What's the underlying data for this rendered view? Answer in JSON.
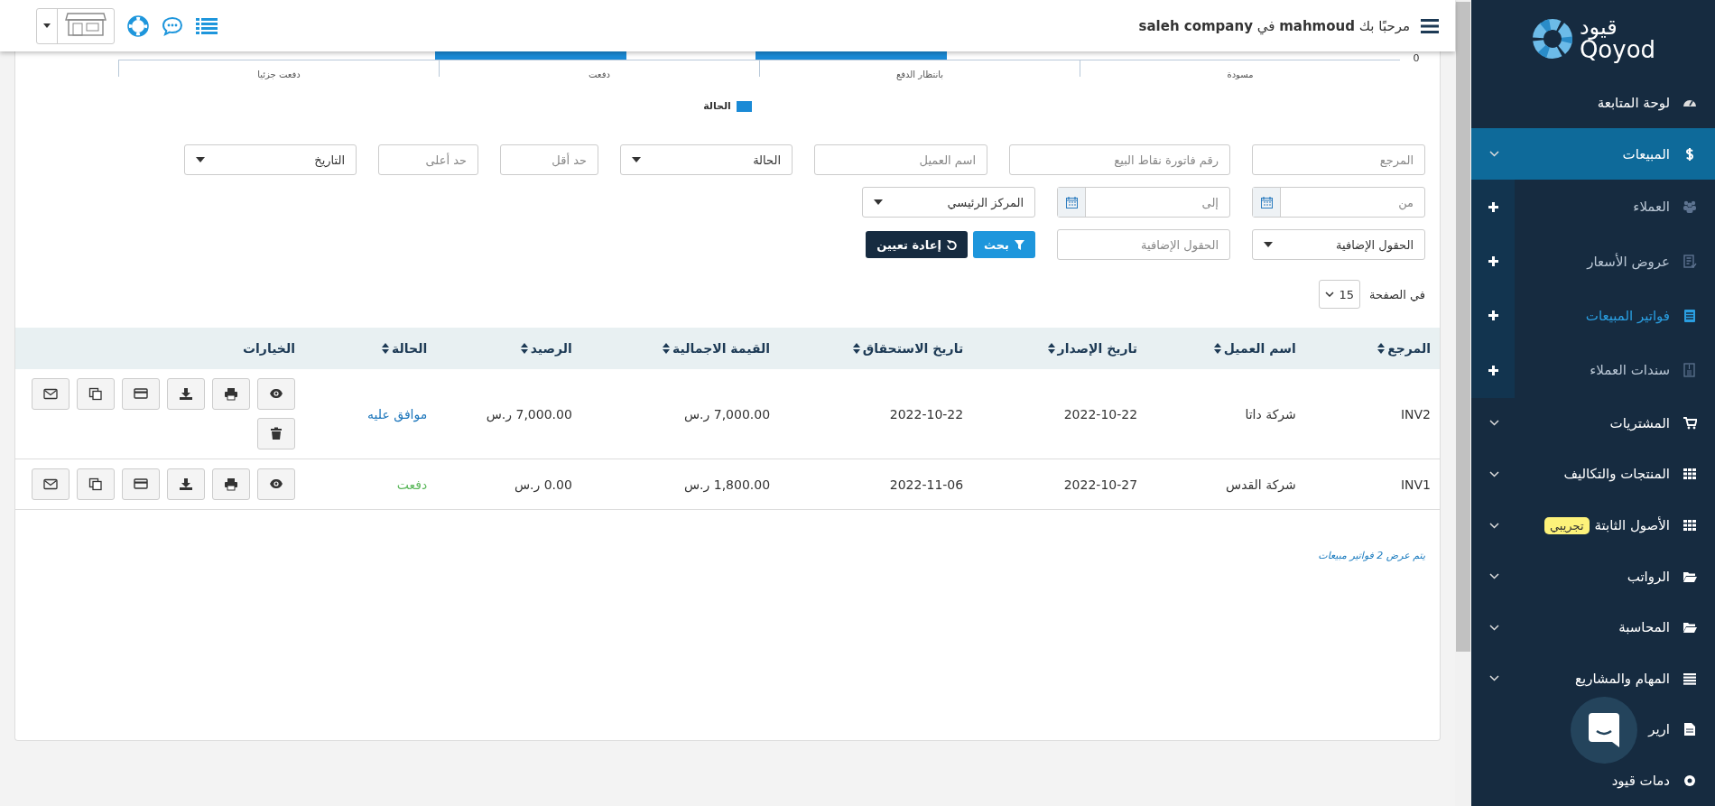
{
  "topbar": {
    "greeting": "مرحبًا بك **mahmoud** في **saleh company**"
  },
  "chart": {
    "zero_tick": "0",
    "legend": "الحالة",
    "categories": [
      {
        "label": "مسودة",
        "bar_visible": false
      },
      {
        "label": "بانتظار الدفع",
        "bar_visible": true
      },
      {
        "label": "دفعت",
        "bar_visible": true
      },
      {
        "label": "دفعت جزئيا",
        "bar_visible": false
      }
    ]
  },
  "filters": [
    [
      {
        "kind": "text",
        "placeholder": "المرجع"
      },
      {
        "kind": "text",
        "placeholder": "رقم فاتورة نقاط البيع"
      },
      {
        "kind": "text",
        "placeholder": "اسم العميل"
      },
      {
        "kind": "select",
        "value": "الحالة"
      },
      {
        "kind": "text",
        "placeholder": "حد أقل"
      },
      {
        "kind": "text",
        "placeholder": "حد أعلى"
      },
      {
        "kind": "select",
        "value": "التاريخ"
      }
    ],
    [
      {
        "kind": "date",
        "placeholder": "من"
      },
      {
        "kind": "date",
        "placeholder": "إلى"
      },
      {
        "kind": "select",
        "value": "المركز الرئيسي"
      }
    ],
    [
      {
        "kind": "select",
        "value": "الحقول الإضافية"
      },
      {
        "kind": "text",
        "placeholder": "الحقول الإضافية"
      }
    ]
  ],
  "buttons": [
    {
      "label": "بحث",
      "kind": "primary"
    },
    {
      "label": "إعادة تعيين",
      "kind": "dark"
    }
  ],
  "per_page": {
    "label": "في الصفحة",
    "value": "15"
  },
  "table": {
    "columns": [
      "المرجع",
      "اسم العميل",
      "تاريخ الإصدار",
      "تاريخ الاستحقاق",
      "القيمة الاجمالية",
      "الرصيد",
      "الحالة",
      "الخيارات"
    ],
    "rows": [
      {
        "cells": [
          "INV2",
          "شركة داتا",
          "2022-10-22",
          "2022-10-22",
          "7,000.00 ر.س",
          "7,000.00 ر.س"
        ],
        "status": {
          "text": "موافق عليه",
          "color": "#1b75bb"
        },
        "deletable": true
      },
      {
        "cells": [
          "INV1",
          "شركة القدس",
          "2022-10-27",
          "2022-11-06",
          "1,800.00 ر.س",
          "0.00 ر.س"
        ],
        "status": {
          "text": "دفعت",
          "color": "#5cb85c"
        },
        "deletable": false
      }
    ]
  },
  "footer": "يتم عرض 2 فواتير مبيعات",
  "sidebar": {
    "logo_ar": "قيود",
    "logo_en": "Qoyod",
    "items": [
      {
        "label": "لوحة المتابعة",
        "kind": "link",
        "selected": false
      },
      {
        "label": "المبيعات",
        "kind": "menu",
        "selected": true,
        "children": [
          {
            "label": "العملاء",
            "selected": false
          },
          {
            "label": "عروض الأسعار",
            "selected": false
          },
          {
            "label": "فواتير المبيعات",
            "selected": true
          },
          {
            "label": "سندات العملاء",
            "selected": false
          }
        ]
      },
      {
        "label": "المشتريات",
        "kind": "menu",
        "selected": false
      },
      {
        "label": "المنتجات والتكاليف",
        "kind": "menu",
        "selected": false
      },
      {
        "label": "الأصول الثابتة",
        "kind": "menu",
        "selected": false,
        "badge": "تجريبي"
      },
      {
        "label": "الرواتب",
        "kind": "menu",
        "selected": false
      },
      {
        "label": "المحاسبة",
        "kind": "menu",
        "selected": false
      },
      {
        "label": "المهام والمشاريع",
        "kind": "menu",
        "selected": false
      },
      {
        "label": "ارير",
        "kind": "link",
        "selected": false
      },
      {
        "label": "دمات قيود",
        "kind": "link",
        "selected": false
      }
    ]
  }
}
